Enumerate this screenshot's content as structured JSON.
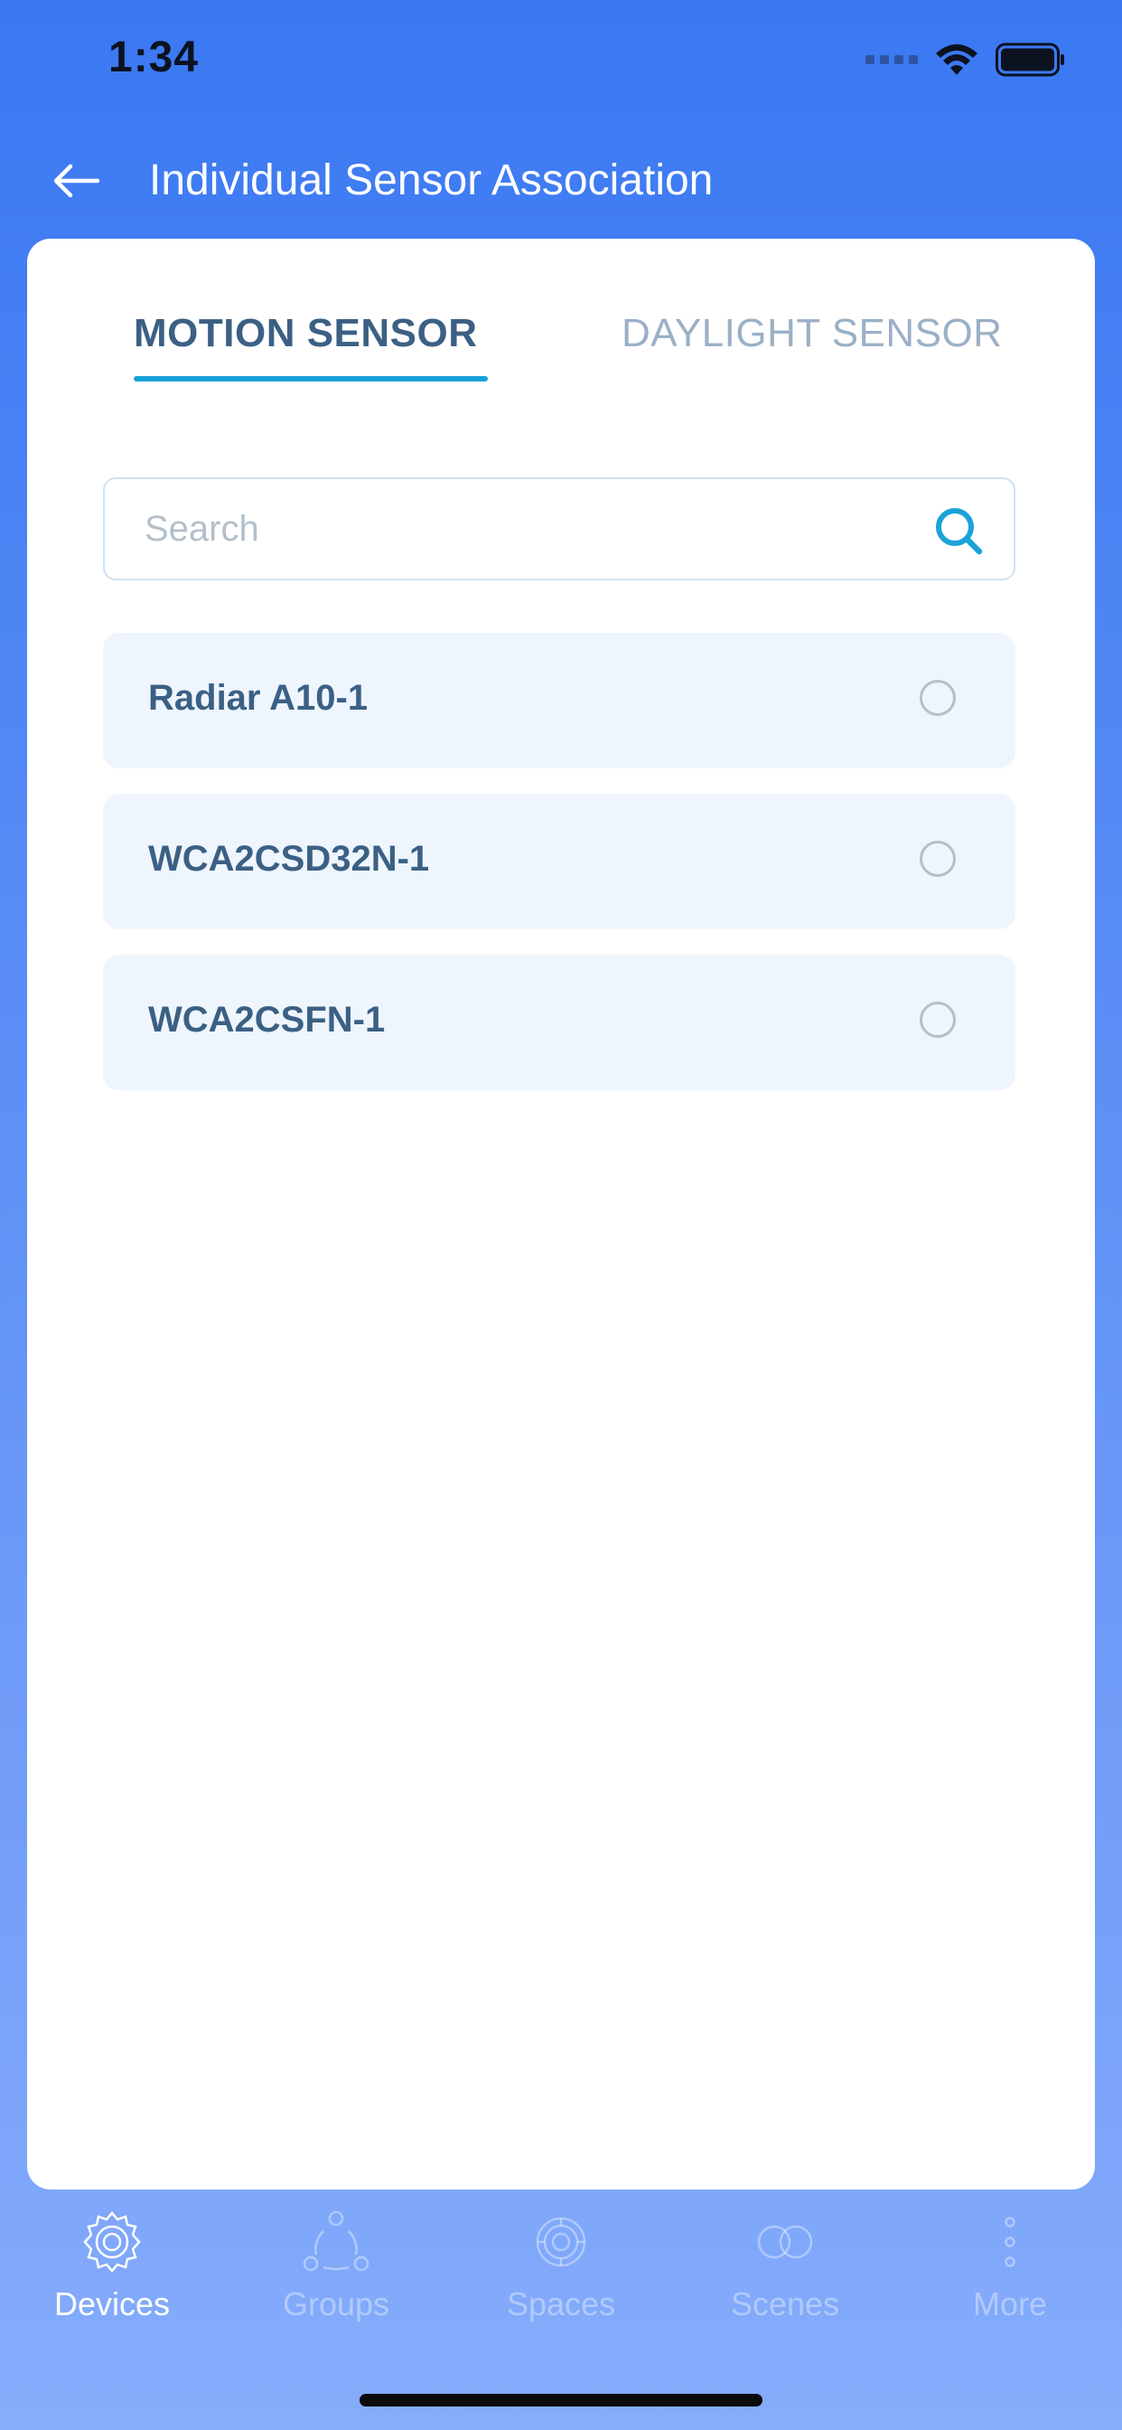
{
  "status_bar": {
    "time": "1:34"
  },
  "header": {
    "title": "Individual Sensor Association",
    "back_icon": "arrow-left-icon"
  },
  "tabs": [
    {
      "label": "MOTION SENSOR",
      "active": true
    },
    {
      "label": "DAYLIGHT SENSOR",
      "active": false
    }
  ],
  "search": {
    "placeholder": "Search",
    "value": "",
    "icon": "search-icon"
  },
  "sensors": [
    {
      "name": "Radiar A10-1",
      "selected": false
    },
    {
      "name": "WCA2CSD32N-1",
      "selected": false
    },
    {
      "name": "WCA2CSFN-1",
      "selected": false
    }
  ],
  "bottom_nav": [
    {
      "label": "Devices",
      "icon": "devices-gear-icon",
      "active": true
    },
    {
      "label": "Groups",
      "icon": "groups-icon",
      "active": false
    },
    {
      "label": "Spaces",
      "icon": "spaces-icon",
      "active": false
    },
    {
      "label": "Scenes",
      "icon": "scenes-icon",
      "active": false
    },
    {
      "label": "More",
      "icon": "more-vertical-icon",
      "active": false
    }
  ],
  "colors": {
    "background_top": "#3a78f2",
    "background_bottom": "#86acfb",
    "accent": "#1aa3d9",
    "text_primary": "#3b6084",
    "tab_inactive": "#9ab0c6",
    "item_background": "#eef5fd"
  }
}
